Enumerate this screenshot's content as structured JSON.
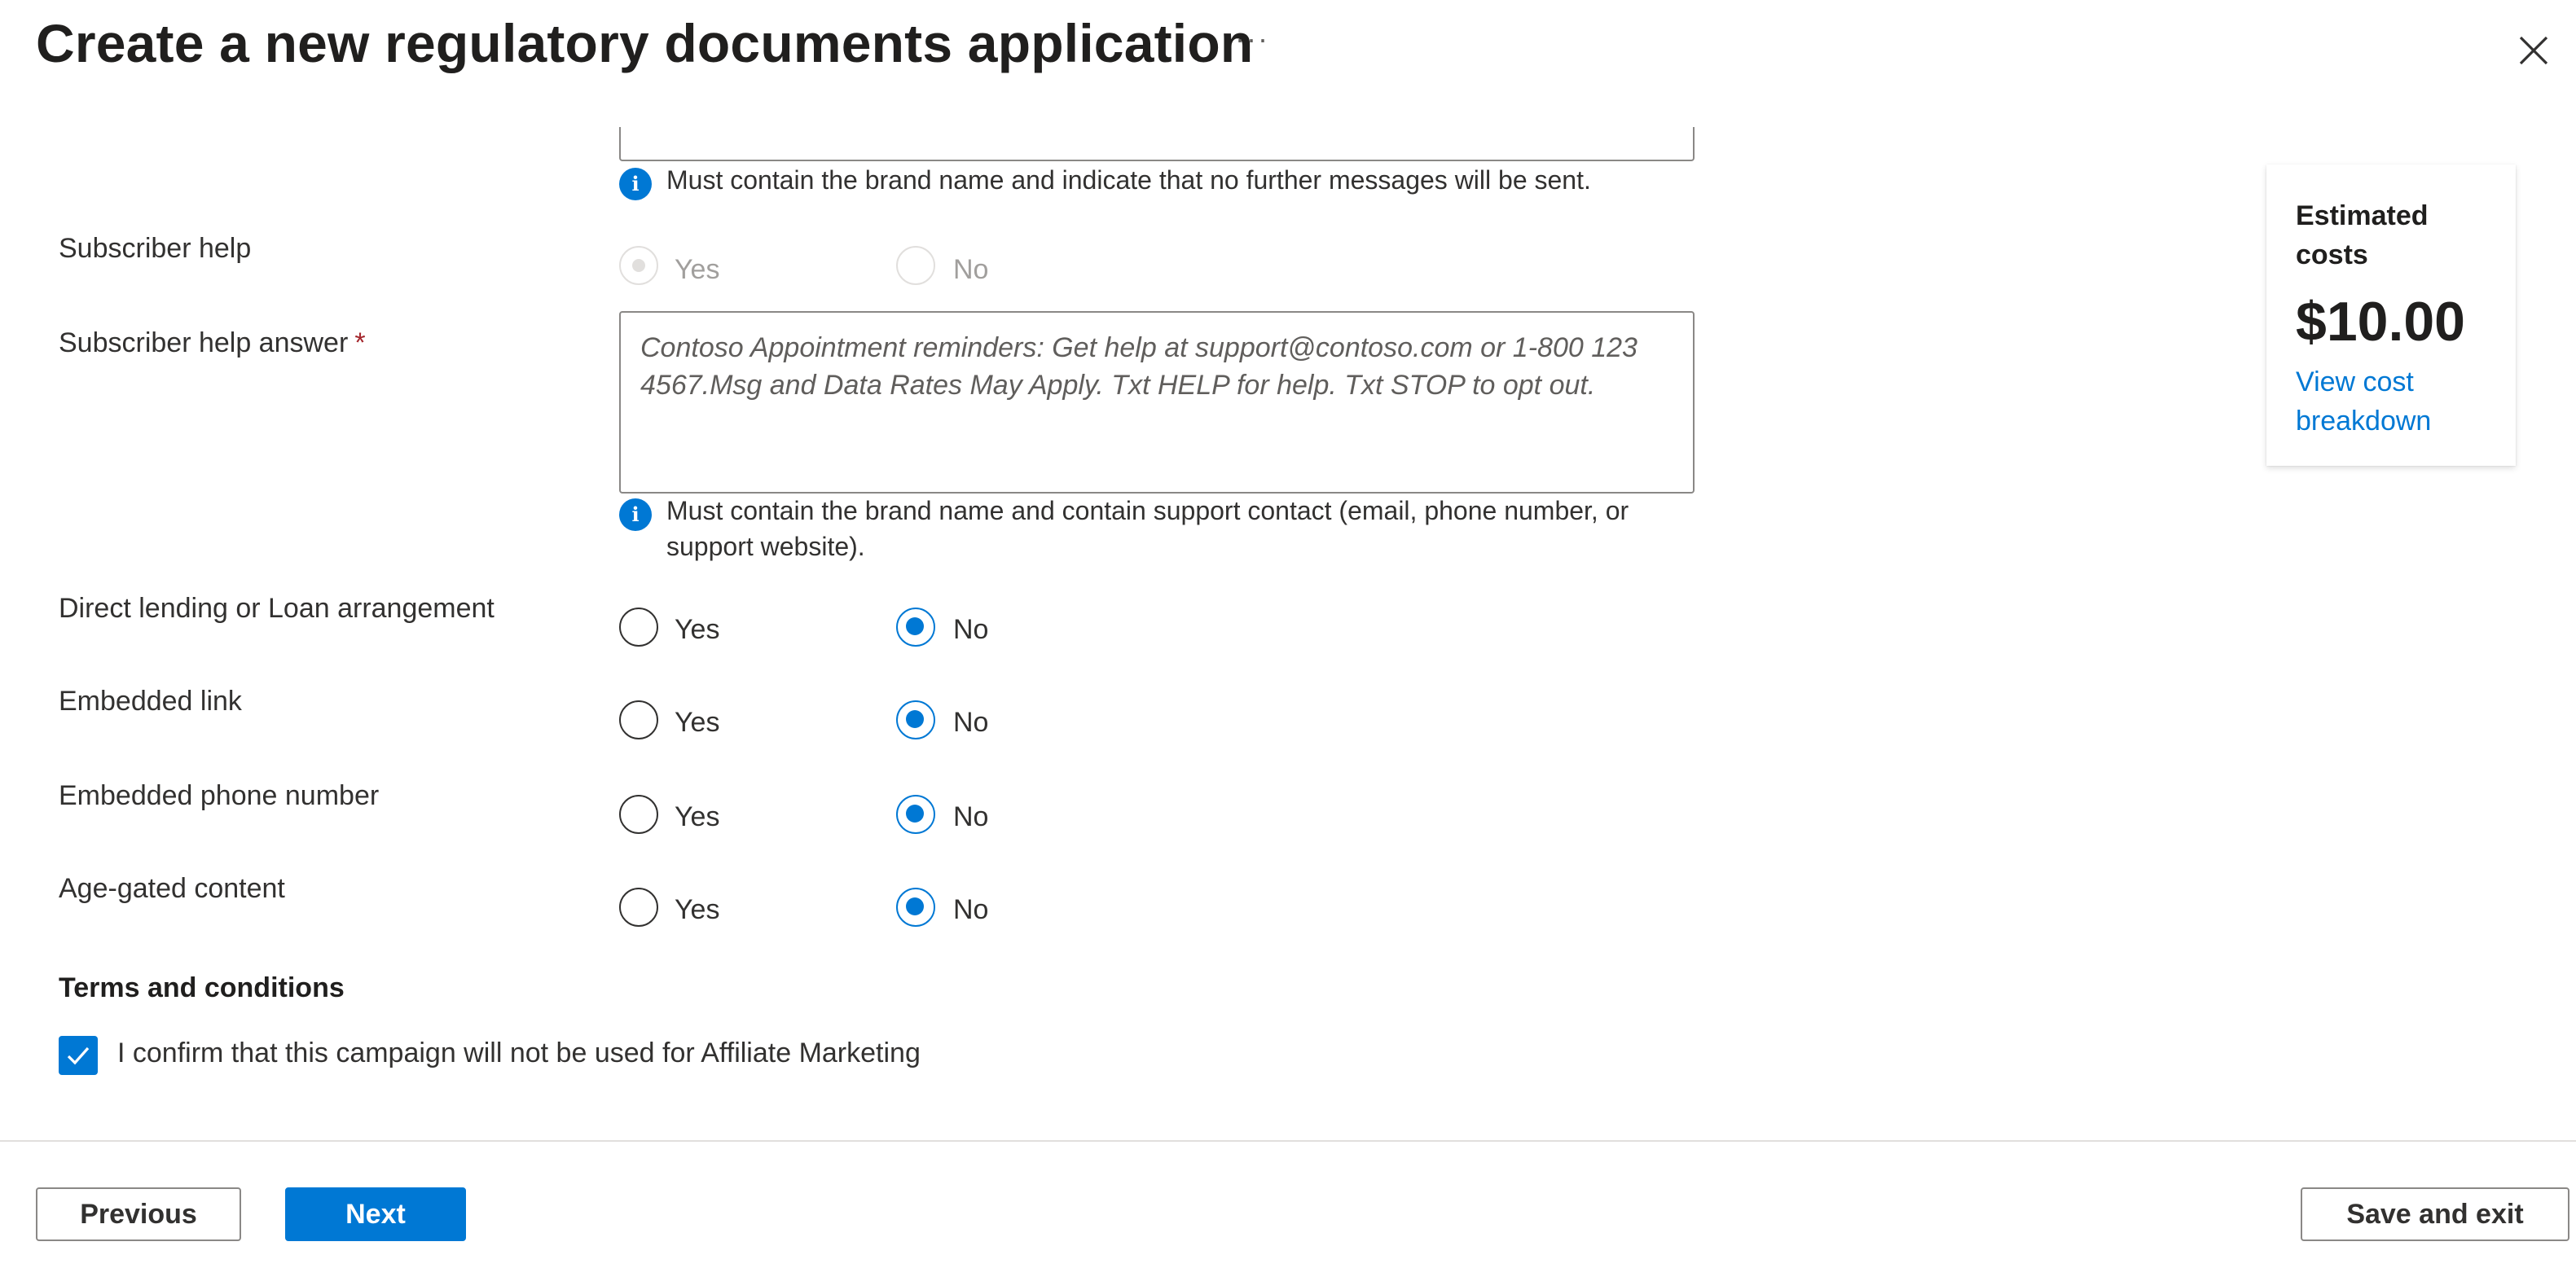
{
  "header": {
    "title": "Create a new regulatory documents application",
    "more_label": "···"
  },
  "form": {
    "opt_out_info": "Must contain the brand name and indicate that no further messages will be sent.",
    "subscriber_help": {
      "label": "Subscriber help",
      "yes": "Yes",
      "no": "No",
      "selected": "Yes"
    },
    "subscriber_help_answer": {
      "label": "Subscriber help answer",
      "required_mark": "*",
      "placeholder": "Contoso Appointment reminders: Get help at support@contoso.com or 1-800 123 4567.Msg and Data Rates May Apply. Txt HELP for help. Txt STOP to opt out.",
      "info": "Must contain the brand name and contain support contact (email, phone number, or support website)."
    },
    "questions": [
      {
        "label": "Direct lending or Loan arrangement",
        "yes": "Yes",
        "no": "No",
        "selected": "No"
      },
      {
        "label": "Embedded link",
        "yes": "Yes",
        "no": "No",
        "selected": "No"
      },
      {
        "label": "Embedded phone number",
        "yes": "Yes",
        "no": "No",
        "selected": "No"
      },
      {
        "label": "Age-gated content",
        "yes": "Yes",
        "no": "No",
        "selected": "No"
      }
    ],
    "terms": {
      "title": "Terms and conditions",
      "checkbox_label": "I confirm that this campaign will not be used for Affiliate Marketing",
      "checked": true
    }
  },
  "cost_card": {
    "title": "Estimated costs",
    "value": "$10.00",
    "link": "View cost breakdown"
  },
  "footer": {
    "previous": "Previous",
    "next": "Next",
    "save_exit": "Save and exit"
  },
  "colors": {
    "accent": "#0078d4",
    "required": "#a4262c"
  },
  "icons": [
    "more-icon",
    "close-icon",
    "info-icon",
    "checkmark-icon"
  ]
}
